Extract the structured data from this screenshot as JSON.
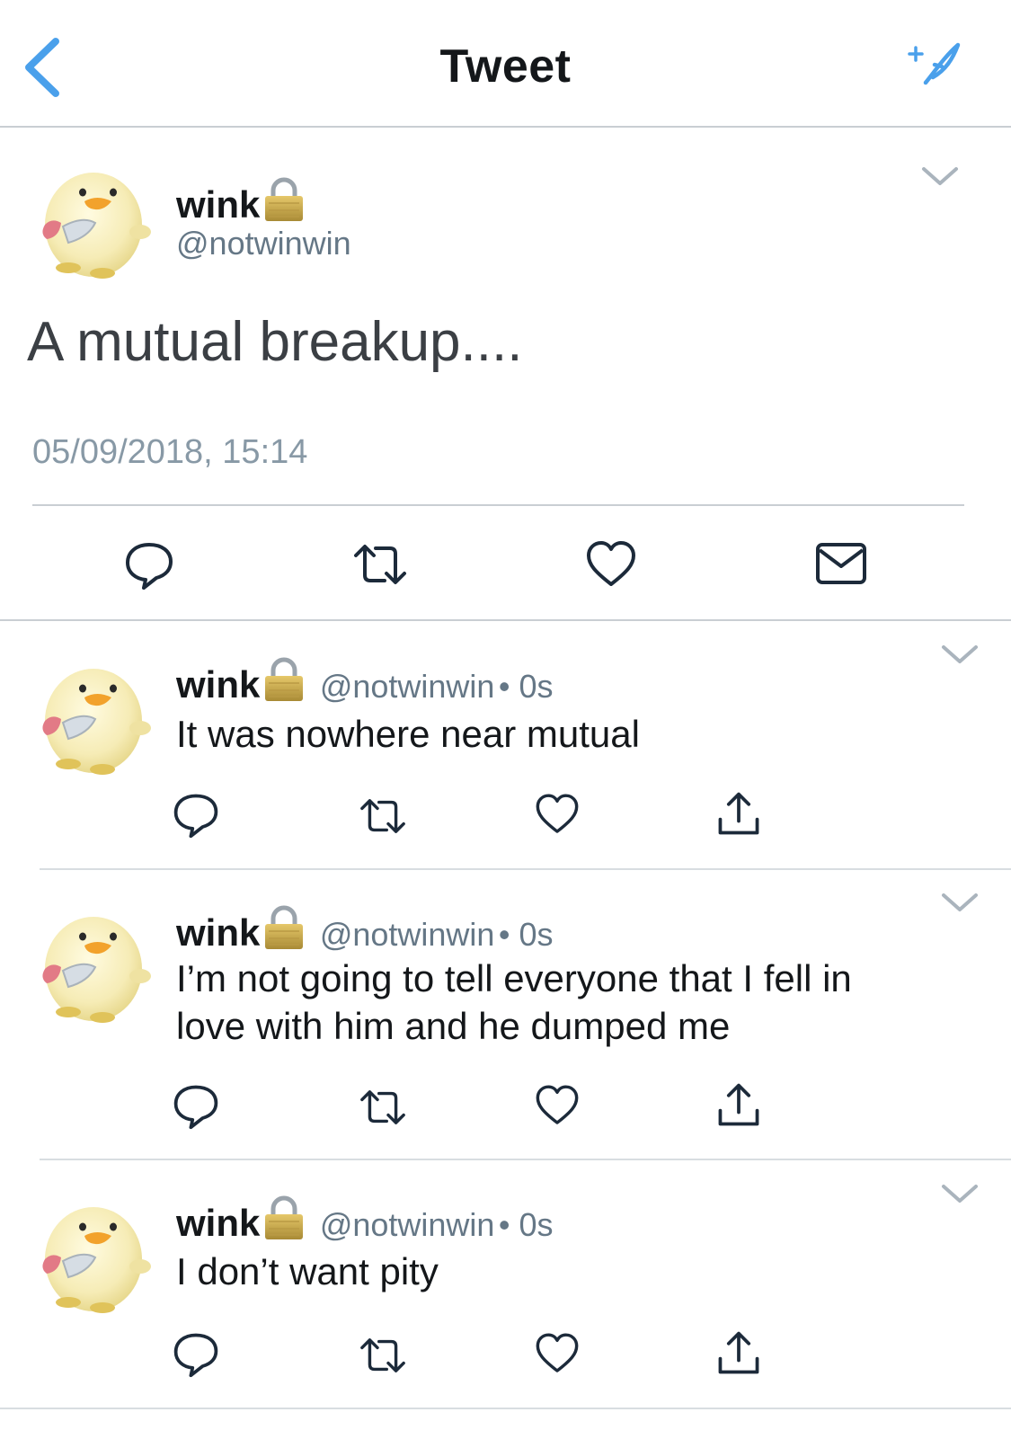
{
  "header": {
    "title": "Tweet",
    "back_icon": "chevron-left-icon",
    "compose_icon": "compose-tweet-icon"
  },
  "colors": {
    "accent": "#4aa0eb",
    "icon": "#1c2a3a",
    "secondary_text": "#657786"
  },
  "main_tweet": {
    "display_name": "wink",
    "handle": "@notwinwin",
    "text": "A mutual breakup....",
    "timestamp": "05/09/2018, 15:14",
    "actions": [
      "reply",
      "retweet",
      "like",
      "direct-message"
    ]
  },
  "replies": [
    {
      "display_name": "wink",
      "handle": "@notwinwin",
      "time": "• 0s",
      "text_lines": [
        "It was nowhere near mutual"
      ]
    },
    {
      "display_name": "wink",
      "handle": "@notwinwin",
      "time": "• 0s",
      "text_lines": [
        "I’m not going to tell everyone that I fell in",
        "love with him and he dumped me"
      ]
    },
    {
      "display_name": "wink",
      "handle": "@notwinwin",
      "time": "• 0s",
      "text_lines": [
        "I don’t want pity"
      ]
    }
  ]
}
